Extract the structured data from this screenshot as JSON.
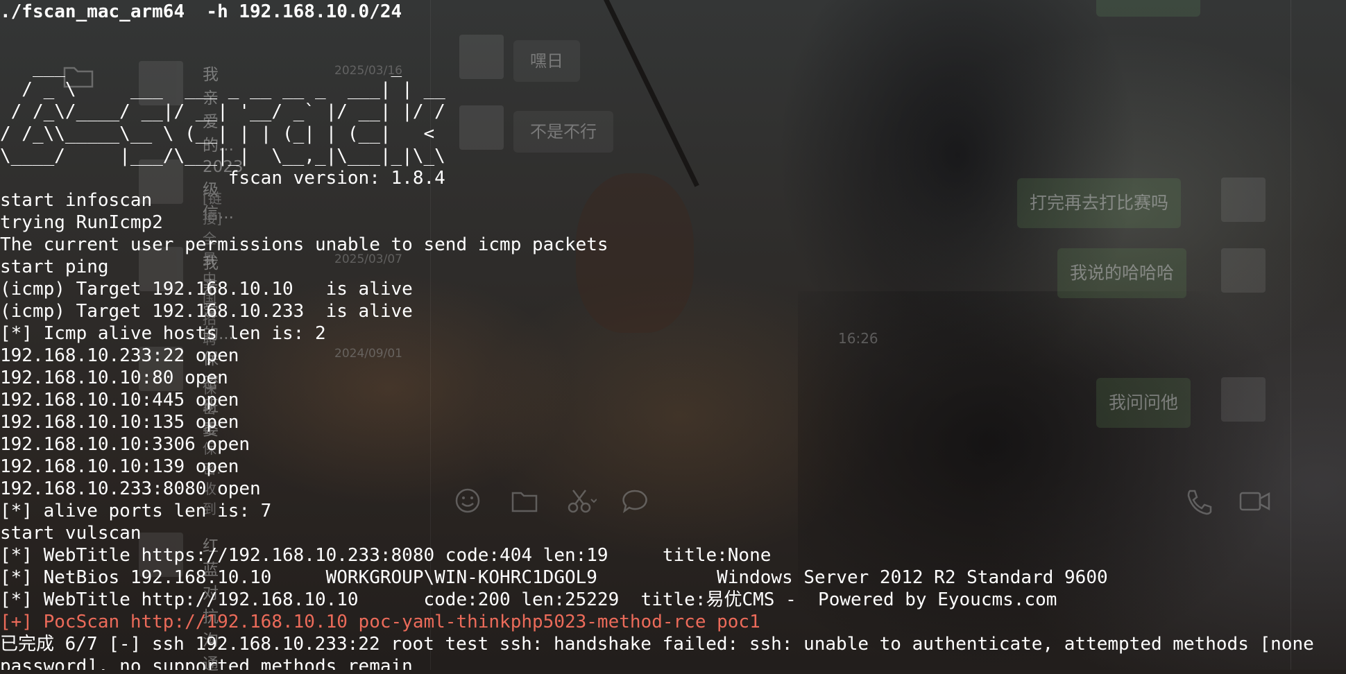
{
  "terminal": {
    "command": "./fscan_mac_arm64  -h 192.168.10.0/24",
    "banner": [
      "   ___                              _    ",
      "  / _ \\     ___  ___ _ __ __ _  ___| | __ ",
      " / /_\\/____/ __|/ __| '__/ _` |/ __| |/ /",
      "/ /_\\\\_____\\__ \\ (__| | | (_| | (__|   <    ",
      "\\____/     |___/\\___|_|  \\__,_|\\___|_|\\_\\   ",
      "                     fscan version: 1.8.4"
    ],
    "output": [
      {
        "text": "start infoscan",
        "style": "normal"
      },
      {
        "text": "trying RunIcmp2",
        "style": "normal"
      },
      {
        "text": "The current user permissions unable to send icmp packets",
        "style": "normal"
      },
      {
        "text": "start ping",
        "style": "normal"
      },
      {
        "text": "(icmp) Target 192.168.10.10   is alive",
        "style": "normal"
      },
      {
        "text": "(icmp) Target 192.168.10.233  is alive",
        "style": "normal"
      },
      {
        "text": "[*] Icmp alive hosts len is: 2",
        "style": "normal"
      },
      {
        "text": "192.168.10.233:22 open",
        "style": "normal"
      },
      {
        "text": "192.168.10.10:80 open",
        "style": "normal"
      },
      {
        "text": "192.168.10.10:445 open",
        "style": "normal"
      },
      {
        "text": "192.168.10.10:135 open",
        "style": "normal"
      },
      {
        "text": "192.168.10.10:3306 open",
        "style": "normal"
      },
      {
        "text": "192.168.10.10:139 open",
        "style": "normal"
      },
      {
        "text": "192.168.10.233:8080 open",
        "style": "normal"
      },
      {
        "text": "[*] alive ports len is: 7",
        "style": "normal"
      },
      {
        "text": "start vulscan",
        "style": "normal"
      },
      {
        "text": "[*] WebTitle https://192.168.10.233:8080 code:404 len:19     title:None",
        "style": "normal"
      },
      {
        "text": "[*] NetBios 192.168.10.10     WORKGROUP\\WIN-KOHRC1DGOL9           Windows Server 2012 R2 Standard 9600",
        "style": "normal"
      },
      {
        "text": "[*] WebTitle http://192.168.10.10      code:200 len:25229  title:易优CMS -  Powered by Eyoucms.com",
        "style": "normal"
      },
      {
        "text": "[+] PocScan http://192.168.10.10 poc-yaml-thinkphp5023-method-rce poc1",
        "style": "red"
      },
      {
        "text": "已完成 6/7 [-] ssh 192.168.10.233:22 root test ssh: handshake failed: ssh: unable to authenticate, attempted methods [none",
        "style": "normal"
      },
      {
        "text": "password], no supported methods remain",
        "style": "normal"
      }
    ],
    "colors": {
      "foreground": "#ffffff",
      "highlight": "#ec6b5a"
    }
  },
  "background_chat": {
    "conversations": [
      {
        "name": "我亲爱的...",
        "date": "2025/03/16"
      },
      {
        "name": "2023级信...",
        "preview": "[链接] 全景中国招聘"
      },
      {
        "name": "我亲爱的...",
        "date": "2025/03/07"
      },
      {
        "name": "保密班委",
        "date": "2024/09/01",
        "preview": "保密正保密: 收到"
      },
      {
        "name": "红蓝对抗沟通"
      }
    ],
    "incoming_messages": [
      "嘿日",
      "不是不行"
    ],
    "outgoing_messages": [
      "打完再去打比赛吗",
      "我说的哈哈哈",
      "我问问他"
    ],
    "message_time": "16:26"
  }
}
